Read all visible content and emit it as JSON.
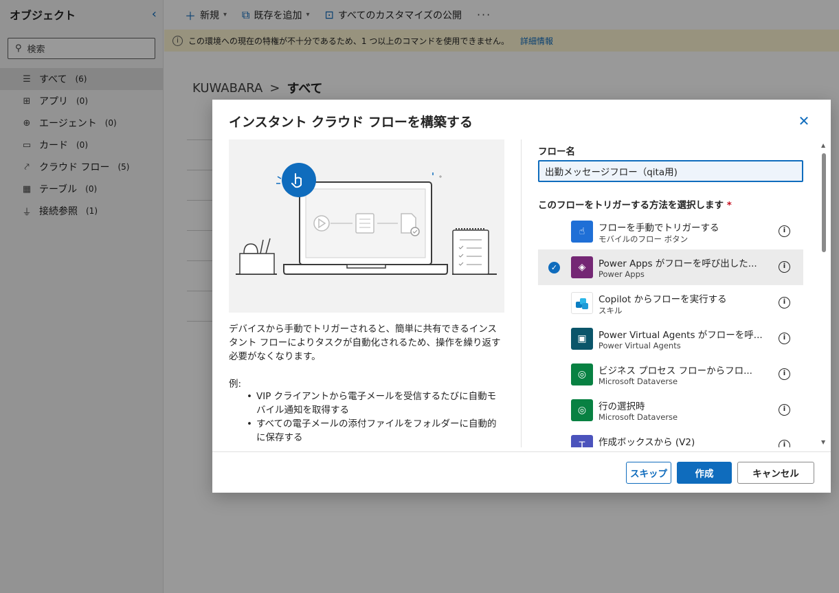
{
  "sidebar": {
    "title": "オブジェクト",
    "search_placeholder": "検索",
    "items": [
      {
        "label": "すべて",
        "count": "(6)",
        "icon": "list-icon"
      },
      {
        "label": "アプリ",
        "count": "(0)",
        "icon": "app-icon"
      },
      {
        "label": "エージェント",
        "count": "(0)",
        "icon": "agent-icon"
      },
      {
        "label": "カード",
        "count": "(0)",
        "icon": "card-icon"
      },
      {
        "label": "クラウド フロー",
        "count": "(5)",
        "icon": "flow-icon"
      },
      {
        "label": "テーブル",
        "count": "(0)",
        "icon": "table-icon"
      },
      {
        "label": "接続参照",
        "count": "(1)",
        "icon": "plug-icon"
      }
    ]
  },
  "commandbar": {
    "new_label": "新規",
    "add_existing_label": "既存を追加",
    "publish_label": "すべてのカスタマイズの公開",
    "more": "···"
  },
  "warning": {
    "text": "この環境への現在の特権が不十分であるため、1 つ以上のコマンドを使用できません。",
    "link": "詳細情報"
  },
  "breadcrumb": {
    "root": "KUWABARA",
    "separator": ">",
    "current": "すべて"
  },
  "dialog": {
    "title": "インスタント クラウド フローを構築する",
    "description": "デバイスから手動でトリガーされると、簡単に共有できるインスタント フローによりタスクが自動化されるため、操作を繰り返す必要がなくなります。",
    "example_label": "例:",
    "examples": [
      "VIP クライアントから電子メールを受信するたびに自動モバイル通知を取得する",
      "すべての電子メールの添付ファイルをフォルダーに自動的に保存する"
    ],
    "flow_name_label": "フロー名",
    "flow_name_value": "出勤メッセージフロー（qita用)",
    "trigger_label": "このフローをトリガーする方法を選択します",
    "required_mark": "*",
    "triggers": [
      {
        "name": "フローを手動でトリガーする",
        "sub": "モバイルのフロー ボタン",
        "icon": "hand-touch-icon",
        "color": "#1f6fd6",
        "selected": false
      },
      {
        "name": "Power Apps がフローを呼び出した...",
        "sub": "Power Apps",
        "icon": "power-apps-icon",
        "color": "#742774",
        "selected": true
      },
      {
        "name": "Copilot からフローを実行する",
        "sub": "スキル",
        "icon": "copilot-icon",
        "color": "#ffffff",
        "selected": false
      },
      {
        "name": "Power Virtual Agents がフローを呼...",
        "sub": "Power Virtual Agents",
        "icon": "pva-icon",
        "color": "#0b556a",
        "selected": false
      },
      {
        "name": "ビジネス プロセス フローからフロ...",
        "sub": "Microsoft Dataverse",
        "icon": "dataverse-icon",
        "color": "#088142",
        "selected": false
      },
      {
        "name": "行の選択時",
        "sub": "Microsoft Dataverse",
        "icon": "dataverse-icon",
        "color": "#088142",
        "selected": false
      },
      {
        "name": "作成ボックスから (V2)",
        "sub": "",
        "icon": "teams-icon",
        "color": "#4b53bc",
        "selected": false
      }
    ],
    "buttons": {
      "skip": "スキップ",
      "create": "作成",
      "cancel": "キャンセル"
    }
  }
}
